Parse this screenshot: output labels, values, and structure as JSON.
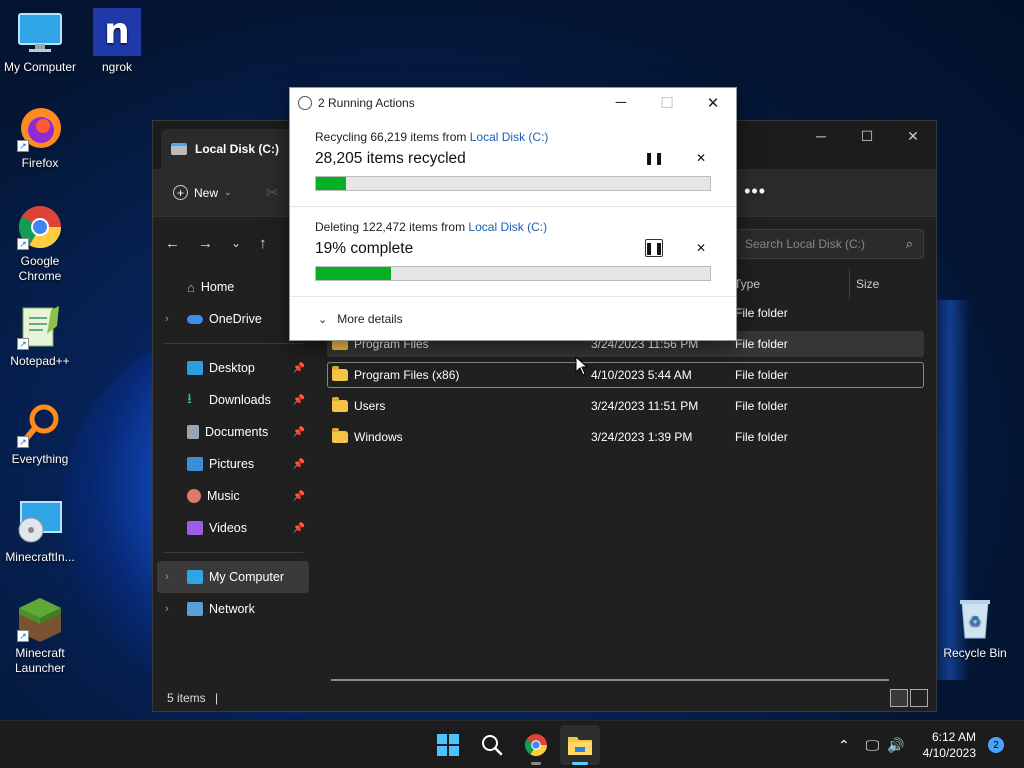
{
  "desktop": {
    "icons": [
      {
        "label": "My Computer"
      },
      {
        "label": "ngrok"
      },
      {
        "label": "Firefox"
      },
      {
        "label": "Google Chrome"
      },
      {
        "label": "Notepad++"
      },
      {
        "label": "Everything"
      },
      {
        "label": "MinecraftIn..."
      },
      {
        "label": "Minecraft Launcher"
      },
      {
        "label": "Recycle Bin"
      }
    ]
  },
  "explorer": {
    "tab_title": "Local Disk (C:)",
    "toolbar": {
      "new_label": "New",
      "more_label": "•••"
    },
    "search_placeholder": "Search Local Disk (C:)",
    "columns": {
      "type": "Type",
      "size": "Size"
    },
    "sidebar": {
      "home": "Home",
      "onedrive": "OneDrive",
      "quick": [
        {
          "label": "Desktop"
        },
        {
          "label": "Downloads"
        },
        {
          "label": "Documents"
        },
        {
          "label": "Pictures"
        },
        {
          "label": "Music"
        },
        {
          "label": "Videos"
        }
      ],
      "my_computer": "My Computer",
      "network": "Network"
    },
    "files": [
      {
        "name": "",
        "date": "",
        "type": "File folder"
      },
      {
        "name": "Program Files",
        "date": "3/24/2023 11:56 PM",
        "type": "File folder"
      },
      {
        "name": "Program Files (x86)",
        "date": "4/10/2023 5:44 AM",
        "type": "File folder"
      },
      {
        "name": "Users",
        "date": "3/24/2023 11:51 PM",
        "type": "File folder"
      },
      {
        "name": "Windows",
        "date": "3/24/2023 1:39 PM",
        "type": "File folder"
      }
    ],
    "status": "5 items"
  },
  "dialog": {
    "title": "2 Running Actions",
    "actions": [
      {
        "head_prefix": "Recycling 66,219 items from ",
        "head_link": "Local Disk (C:)",
        "progress_text": "28,205 items recycled",
        "progress_fraction": 0.075
      },
      {
        "head_prefix": "Deleting 122,472 items from ",
        "head_link": "Local Disk (C:)",
        "progress_text": "19% complete",
        "progress_fraction": 0.19
      }
    ],
    "more_details": "More details"
  },
  "taskbar": {
    "time": "6:12 AM",
    "date": "4/10/2023",
    "notification_count": "2"
  },
  "colors": {
    "progress_green": "#06b025",
    "link_blue": "#1a5fb4",
    "accent": "#60cdff"
  }
}
